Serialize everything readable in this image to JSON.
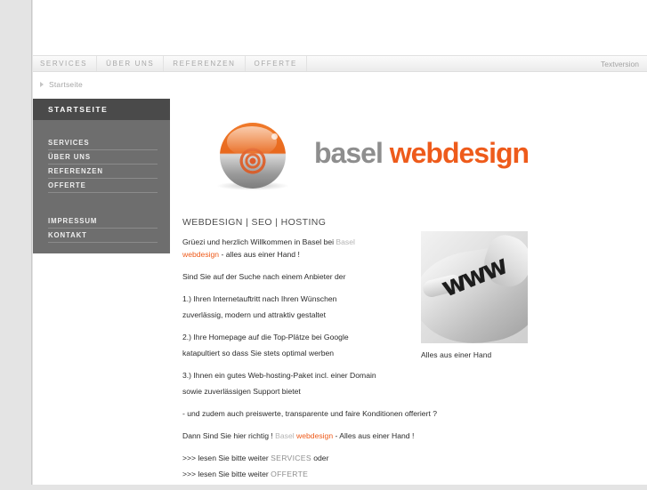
{
  "topnav": {
    "items": [
      {
        "label": "SERVICES"
      },
      {
        "label": "ÜBER UNS"
      },
      {
        "label": "REFERENZEN"
      },
      {
        "label": "OFFERTE"
      }
    ],
    "textversion": "Textversion"
  },
  "breadcrumb": {
    "current": "Startseite"
  },
  "sidebar": {
    "title": "STARTSEITE",
    "items": [
      {
        "label": "SERVICES"
      },
      {
        "label": "ÜBER UNS"
      },
      {
        "label": "REFERENZEN"
      },
      {
        "label": "OFFERTE"
      }
    ],
    "items_secondary": [
      {
        "label": "IMPRESSUM"
      },
      {
        "label": "KONTAKT"
      }
    ]
  },
  "logo": {
    "word_primary": "basel",
    "word_accent": "webdesign",
    "color_primary": "#8e8e8e",
    "color_accent": "#ee5b1b"
  },
  "article": {
    "heading": "WEBDESIGN | SEO | HOSTING",
    "intro_a": "Grüezi und herzlich Willkommen in Basel bei ",
    "intro_brand_gray": "Basel",
    "intro_brand_orange": "webdesign",
    "intro_b": " - alles aus einer Hand !",
    "question": "Sind Sie auf der Suche nach einem Anbieter der",
    "point1_line1": "1.) Ihren Internetauftritt nach Ihren Wünschen",
    "point1_line2": "zuverlässig, modern und attraktiv gestaltet",
    "point2_line1": "2.) Ihre Homepage auf die Top-Plätze bei Google",
    "point2_line2": "katapultiert so dass Sie stets optimal werben",
    "point3_line1": "3.) Ihnen ein gutes Web-hosting-Paket incl. einer Domain",
    "point3_line2": "sowie zuverlässigen Support bietet",
    "closing_question": "- und zudem auch preiswerte, transparente und faire Konditionen offeriert ?",
    "cta_a": "Dann Sind Sie hier richtig ! ",
    "cta_brand_gray": "Basel",
    "cta_brand_orange": "webdesign",
    "cta_b": " - Alles aus einer Hand !",
    "readmore1_a": ">>> lesen Sie bitte weiter ",
    "readmore1_link": "SERVICES",
    "readmore1_b": " oder",
    "readmore2_a": ">>> lesen Sie bitte weiter ",
    "readmore2_link": "OFFERTE"
  },
  "figure": {
    "caption": "Alles aus einer Hand",
    "photo_text": "www"
  }
}
